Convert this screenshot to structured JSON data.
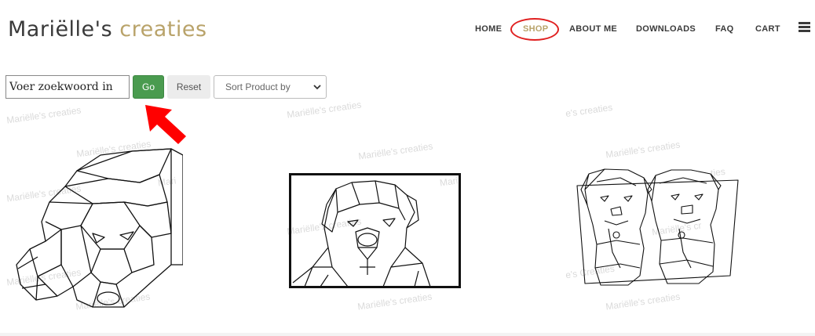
{
  "brand": {
    "name_part1": "Mariëlle's",
    "name_part2": "creaties"
  },
  "nav": {
    "items": [
      {
        "label": "HOME",
        "active": false
      },
      {
        "label": "SHOP",
        "active": true
      },
      {
        "label": "ABOUT ME",
        "active": false
      },
      {
        "label": "DOWNLOADS",
        "active": false
      },
      {
        "label": "FAQ",
        "active": false
      },
      {
        "label": "CART",
        "active": false
      }
    ],
    "menu_icon": "hamburger-icon"
  },
  "search": {
    "value": "Voer zoekwoord in",
    "go_label": "Go",
    "reset_label": "Reset",
    "sort_label": "Sort Product by"
  },
  "annotation": {
    "arrow_color": "#ff0000",
    "circle_color": "#e02020"
  },
  "watermark_text": "Mariëlle's creaties",
  "watermarks_partial": [
    "Mari",
    "e's creaties",
    "Mari",
    "e's Creaties",
    "ties",
    "Mariëlle's cr"
  ],
  "colors": {
    "brand_gold": "#b9a36a",
    "go_green": "#4a9b4f",
    "text_dark": "#3a3a3a"
  },
  "products": [
    {
      "icon": "lying-dog-line-art"
    },
    {
      "icon": "framed-dog-portrait-line-art"
    },
    {
      "icon": "two-dogs-line-art"
    }
  ]
}
